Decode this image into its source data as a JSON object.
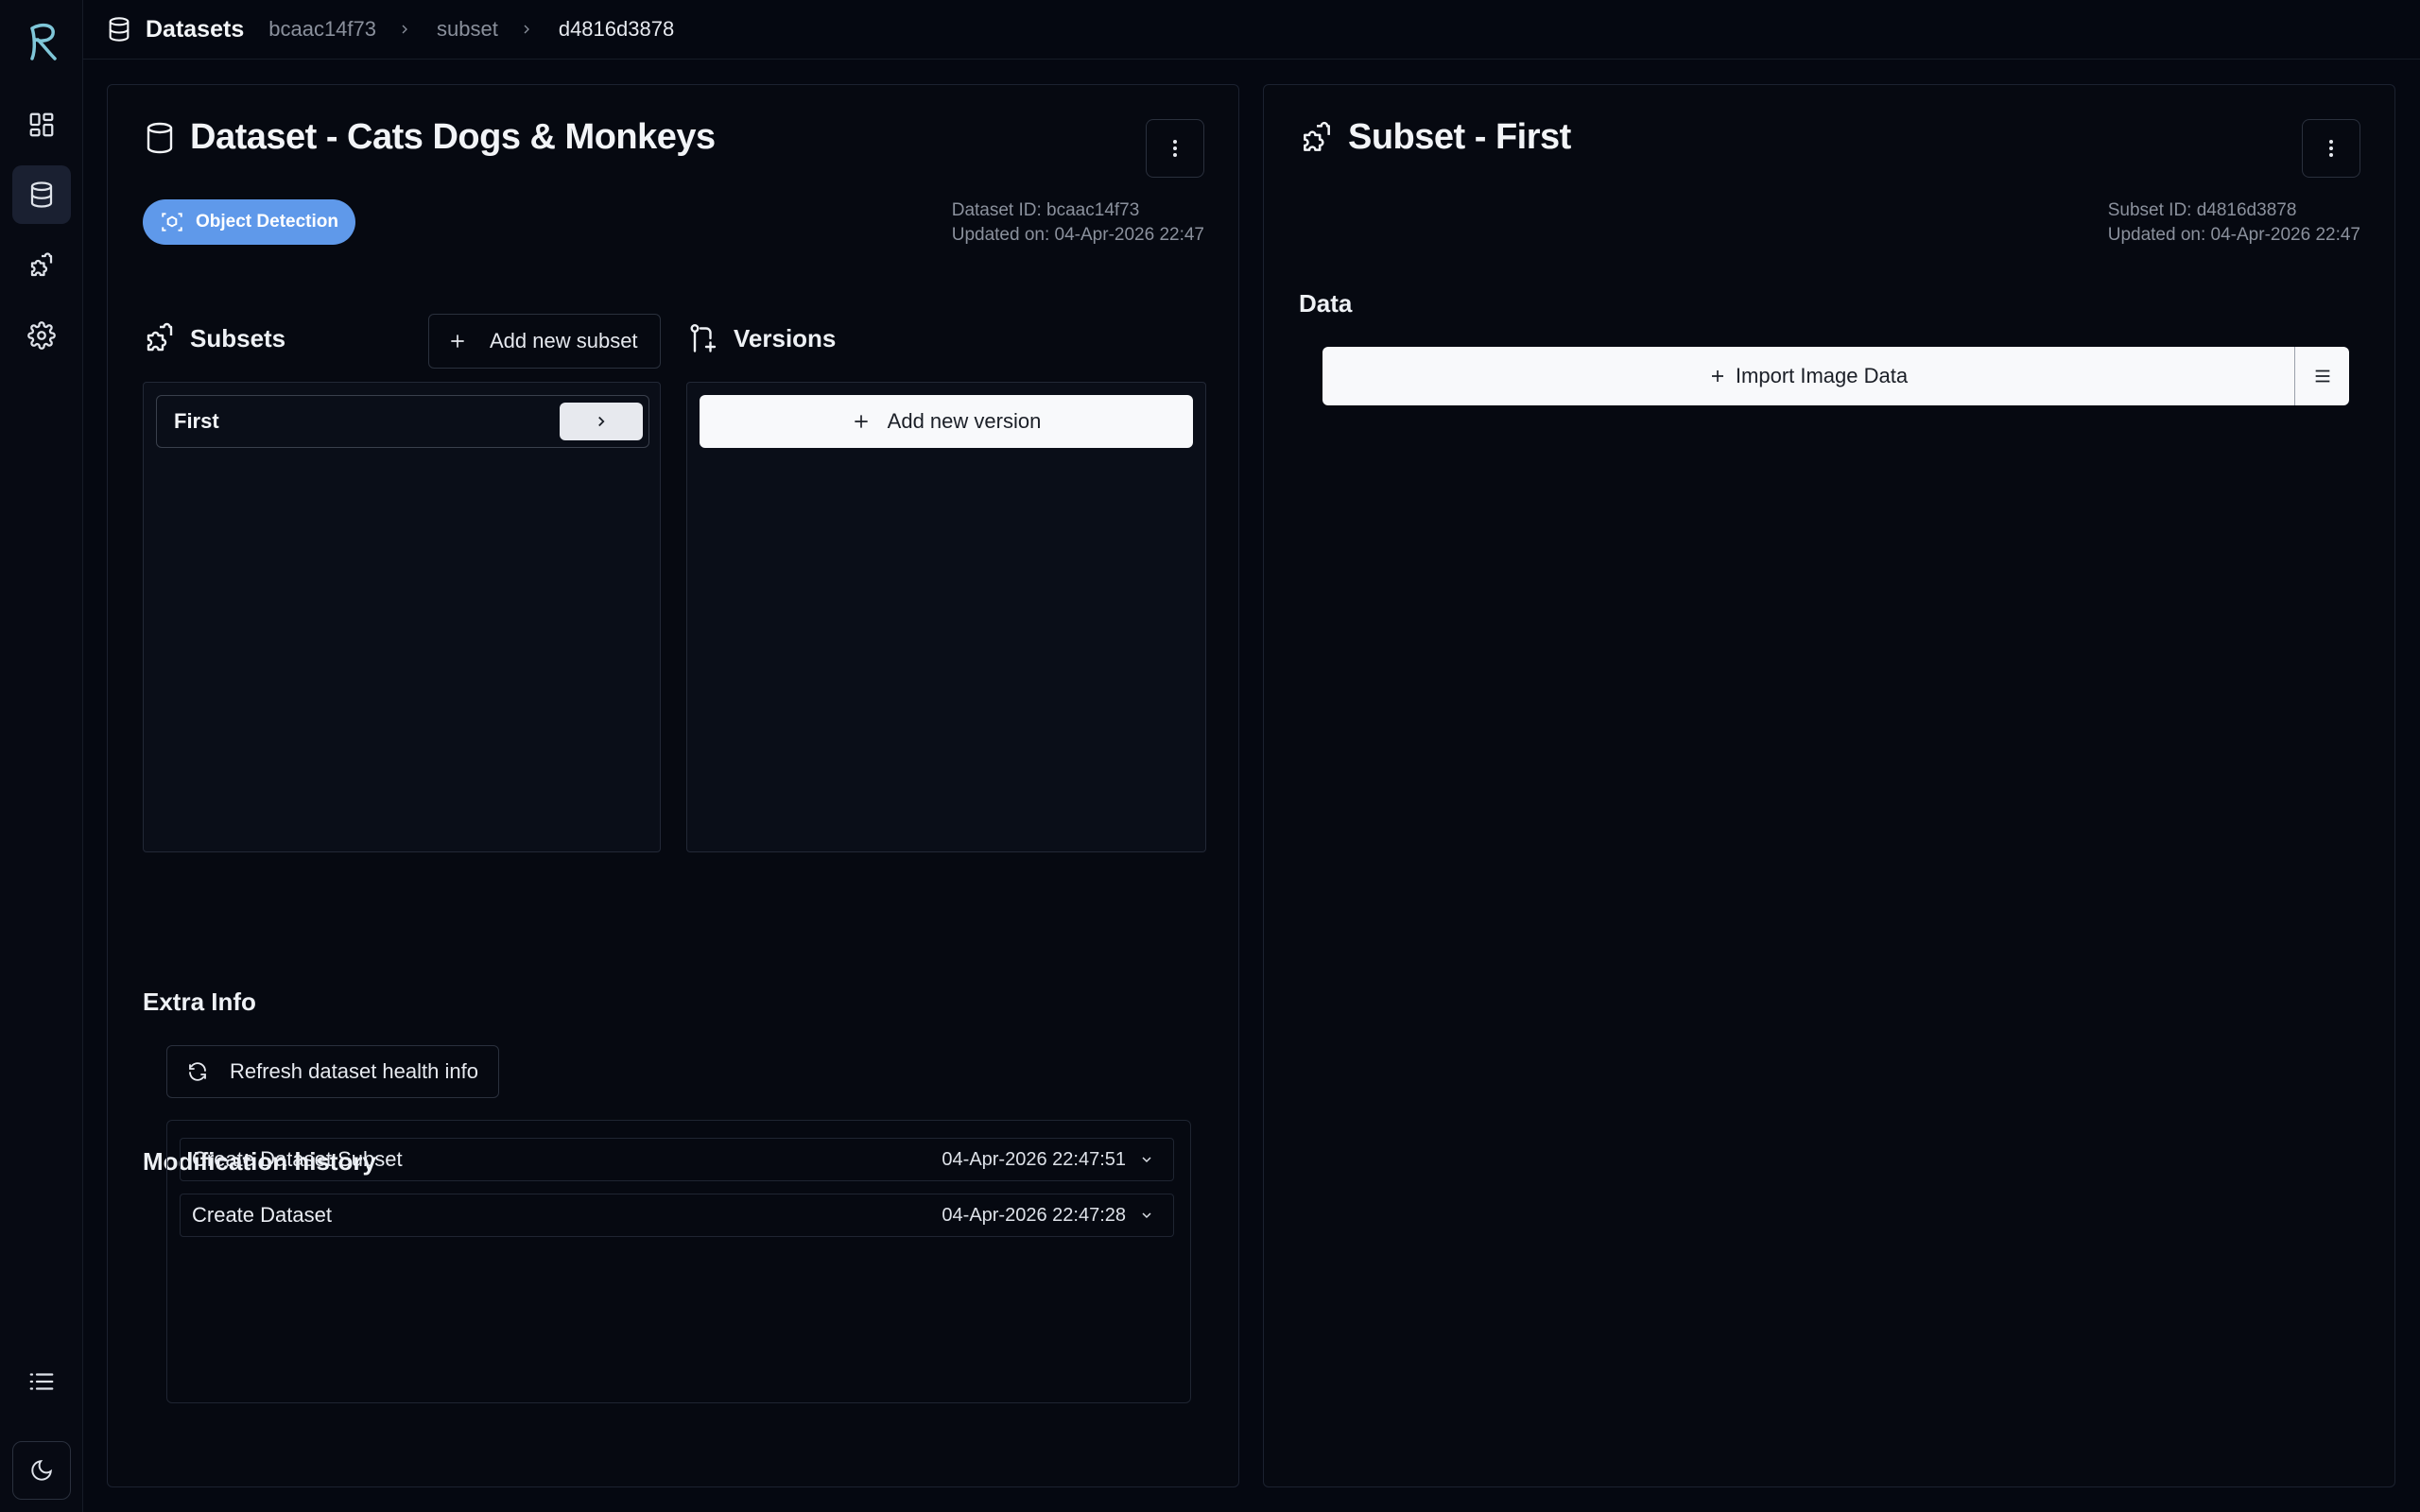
{
  "breadcrumb": {
    "root": "Datasets",
    "dataset_id": "bcaac14f73",
    "section": "subset",
    "subset_id": "d4816d3878"
  },
  "dataset": {
    "title": "Dataset - Cats Dogs & Monkeys",
    "type_badge": "Object Detection",
    "id_line": "Dataset ID: bcaac14f73",
    "updated_line": "Updated on: 04-Apr-2026 22:47",
    "subsets_heading": "Subsets",
    "add_subset_label": "Add new subset",
    "subsets": [
      {
        "name": "First"
      }
    ],
    "versions_heading": "Versions",
    "add_version_label": "Add new version",
    "extra_info_heading": "Extra Info",
    "refresh_label": "Refresh dataset health info",
    "history_heading": "Modification history",
    "history": [
      {
        "action": "Create Dataset Subset",
        "time": "04-Apr-2026 22:47:51"
      },
      {
        "action": "Create Dataset",
        "time": "04-Apr-2026 22:47:28"
      }
    ]
  },
  "subset": {
    "title": "Subset - First",
    "id_line": "Subset ID: d4816d3878",
    "updated_line": "Updated on: 04-Apr-2026 22:47",
    "data_heading": "Data",
    "import_label": "Import Image Data"
  },
  "colors": {
    "background": "#050811",
    "accent_badge": "#5f99ea",
    "logo_teal": "#7fc7d9"
  },
  "icons": {
    "logo": "r-logo-icon",
    "sidebar": [
      "dashboard-icon",
      "database-icon",
      "puzzle-icon",
      "gear-icon",
      "list-icon",
      "moon-icon"
    ]
  }
}
